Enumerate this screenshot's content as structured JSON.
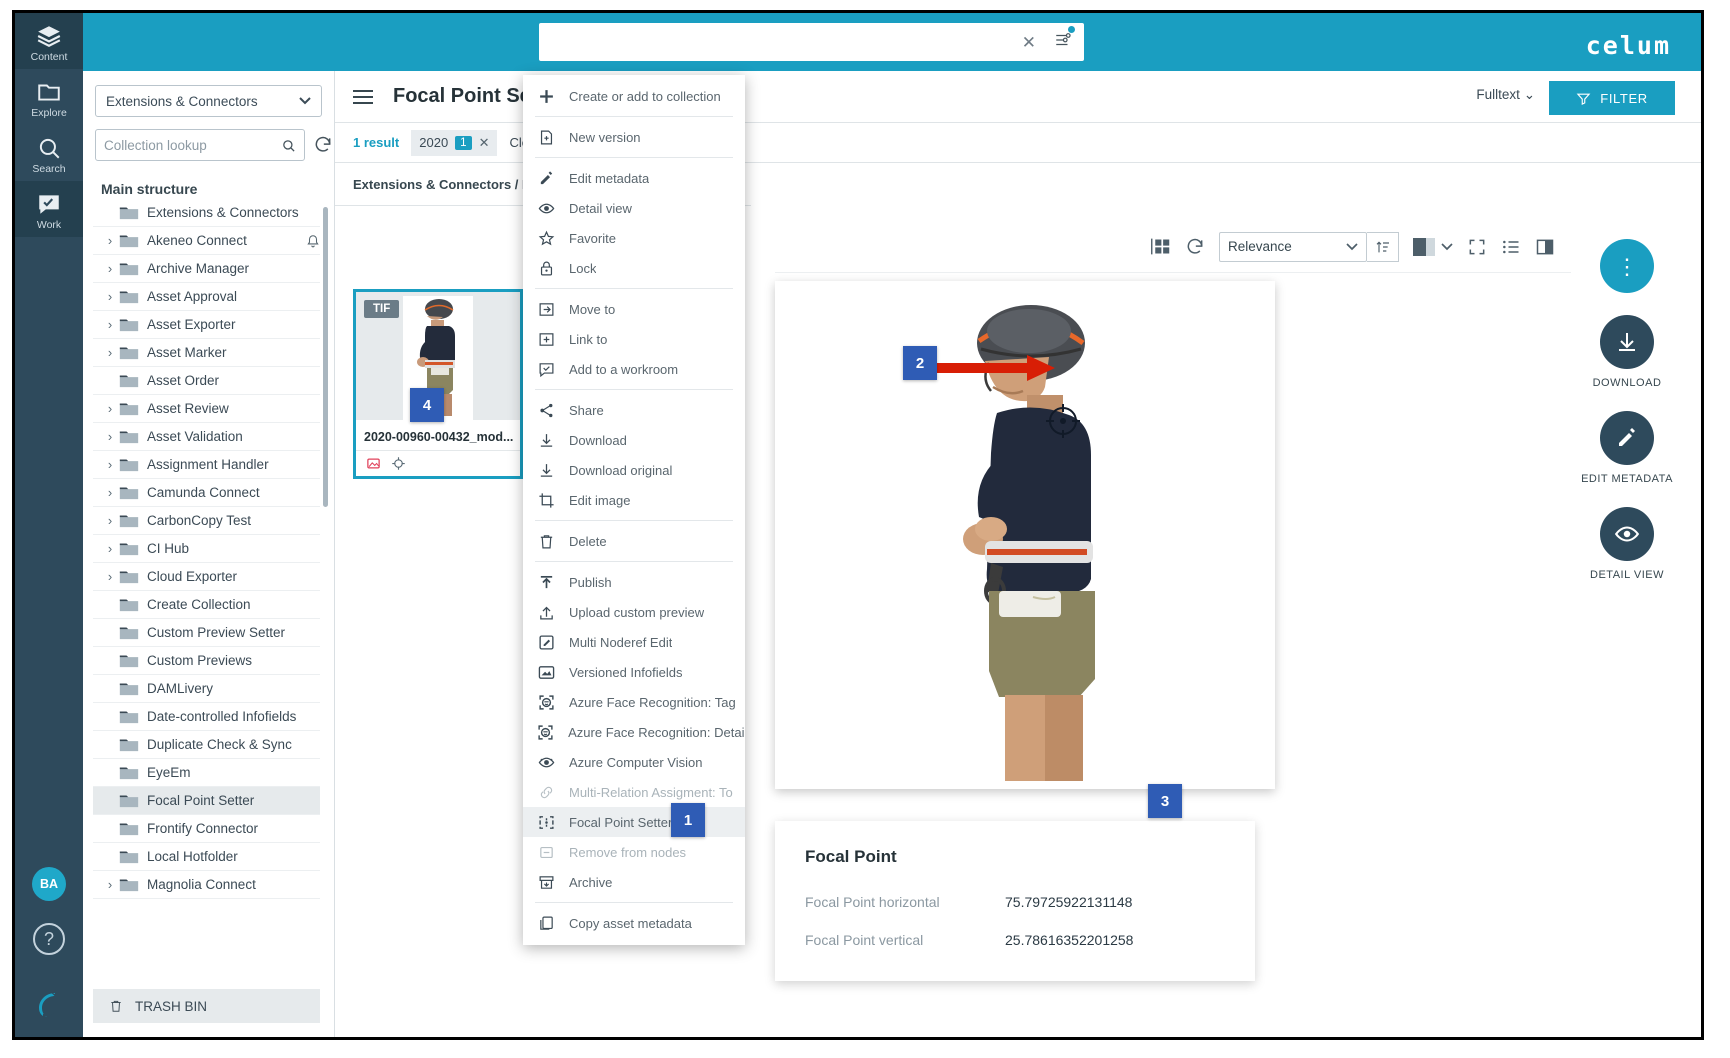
{
  "app": {
    "brand": "celum"
  },
  "rail": {
    "items": [
      {
        "label": "Content",
        "icon": "layers-icon",
        "active": true
      },
      {
        "label": "Explore",
        "icon": "folder-icon",
        "active": false
      },
      {
        "label": "Search",
        "icon": "search-icon",
        "active": false
      },
      {
        "label": "Work",
        "icon": "checkbox-chat-icon",
        "active": true
      }
    ],
    "avatar": "BA",
    "help": "?"
  },
  "topbar": {
    "search_value": "",
    "search_placeholder": "",
    "clear_icon": "close-icon",
    "settings_icon": "search-settings-icon"
  },
  "left_panel": {
    "collection_select": "Extensions & Connectors",
    "lookup_placeholder": "Collection lookup",
    "lookup_value": "",
    "section_title": "Main structure",
    "root": "Extensions & Connectors",
    "nodes": [
      {
        "label": "Akeneo Connect",
        "expandable": true,
        "bell": true
      },
      {
        "label": "Archive Manager",
        "expandable": true
      },
      {
        "label": "Asset Approval",
        "expandable": true
      },
      {
        "label": "Asset Exporter",
        "expandable": true
      },
      {
        "label": "Asset Marker",
        "expandable": true
      },
      {
        "label": "Asset Order",
        "expandable": false
      },
      {
        "label": "Asset Review",
        "expandable": true
      },
      {
        "label": "Asset Validation",
        "expandable": true
      },
      {
        "label": "Assignment Handler",
        "expandable": true
      },
      {
        "label": "Camunda Connect",
        "expandable": true
      },
      {
        "label": "CarbonCopy Test",
        "expandable": true
      },
      {
        "label": "CI Hub",
        "expandable": true
      },
      {
        "label": "Cloud Exporter",
        "expandable": true
      },
      {
        "label": "Create Collection",
        "expandable": false
      },
      {
        "label": "Custom Preview Setter",
        "expandable": false
      },
      {
        "label": "Custom Previews",
        "expandable": false
      },
      {
        "label": "DAMLivery",
        "expandable": false
      },
      {
        "label": "Date-controlled Infofields",
        "expandable": false
      },
      {
        "label": "Duplicate Check & Sync",
        "expandable": false
      },
      {
        "label": "EyeEm",
        "expandable": false
      },
      {
        "label": "Focal Point Setter",
        "expandable": false,
        "selected": true
      },
      {
        "label": "Frontify Connector",
        "expandable": false
      },
      {
        "label": "Local Hotfolder",
        "expandable": false
      },
      {
        "label": "Magnolia Connect",
        "expandable": true
      }
    ],
    "trash": "TRASH BIN"
  },
  "center": {
    "page_title": "Focal Point Se",
    "fulltext": "Fulltext",
    "filter_button": "FILTER",
    "result_count": "1 result",
    "chip_label": "2020",
    "chip_badge": "1",
    "clear_label": "Clea",
    "breadcrumb": "Extensions & Connectors / F"
  },
  "asset_card": {
    "type_badge": "TIF",
    "name": "2020-00960-00432_mod..."
  },
  "toolbar": {
    "grid_icon": "grid-view-icon",
    "refresh_icon": "refresh-icon",
    "sort_value": "Relevance",
    "sort_dir_icon": "sort-ascending-icon",
    "thumb_size_icon": "thumbnail-size-icon",
    "fullscreen_icon": "fullscreen-icon",
    "list_icon": "list-view-icon",
    "split_icon": "split-view-icon"
  },
  "focal_point": {
    "title": "Focal Point",
    "rows": [
      {
        "label": "Focal Point horizontal",
        "value": "75.79725922131148"
      },
      {
        "label": "Focal Point vertical",
        "value": "25.78616352201258"
      }
    ]
  },
  "actions": [
    {
      "label": "DOWNLOAD",
      "icon": "download-icon"
    },
    {
      "label": "EDIT METADATA",
      "icon": "pencil-icon"
    },
    {
      "label": "DETAIL VIEW",
      "icon": "eye-icon"
    }
  ],
  "context_menu": {
    "items": [
      {
        "label": "Create or add to collection",
        "icon": "plus-icon",
        "sep_after": true
      },
      {
        "label": "New version",
        "icon": "new-version-icon",
        "sep_after": true
      },
      {
        "label": "Edit metadata",
        "icon": "pencil-icon"
      },
      {
        "label": "Detail view",
        "icon": "eye-icon"
      },
      {
        "label": "Favorite",
        "icon": "star-icon"
      },
      {
        "label": "Lock",
        "icon": "lock-icon",
        "sep_after": true
      },
      {
        "label": "Move to",
        "icon": "move-to-icon"
      },
      {
        "label": "Link to",
        "icon": "link-to-icon"
      },
      {
        "label": "Add to a workroom",
        "icon": "workroom-icon",
        "sep_after": true
      },
      {
        "label": "Share",
        "icon": "share-icon"
      },
      {
        "label": "Download",
        "icon": "download-icon"
      },
      {
        "label": "Download original",
        "icon": "download-original-icon"
      },
      {
        "label": "Edit image",
        "icon": "crop-icon",
        "sep_after": true
      },
      {
        "label": "Delete",
        "icon": "trash-icon",
        "sep_after": true
      },
      {
        "label": "Publish",
        "icon": "publish-icon"
      },
      {
        "label": "Upload custom preview",
        "icon": "upload-icon"
      },
      {
        "label": "Multi Noderef Edit",
        "icon": "multi-noderef-icon"
      },
      {
        "label": "Versioned Infofields",
        "icon": "versioned-infofields-icon"
      },
      {
        "label": "Azure Face Recognition: Tag",
        "icon": "face-recognition-icon"
      },
      {
        "label": "Azure Face Recognition: Details",
        "icon": "face-recognition-icon"
      },
      {
        "label": "Azure Computer Vision",
        "icon": "computer-vision-icon"
      },
      {
        "label": "Multi-Relation Assigment: To",
        "icon": "link-chain-icon",
        "dim": true
      },
      {
        "label": "Focal Point Setter",
        "icon": "focal-point-icon",
        "selected": true
      },
      {
        "label": "Remove from nodes",
        "icon": "remove-from-nodes-icon",
        "dim": true
      },
      {
        "label": "Archive",
        "icon": "archive-icon",
        "sep_after": true
      },
      {
        "label": "Copy asset metadata",
        "icon": "copy-metadata-icon"
      }
    ]
  },
  "callouts": [
    {
      "id": "badge1",
      "number": "1"
    },
    {
      "id": "badge2",
      "number": "2"
    },
    {
      "id": "badge3",
      "number": "3"
    },
    {
      "id": "badge4",
      "number": "4"
    }
  ]
}
